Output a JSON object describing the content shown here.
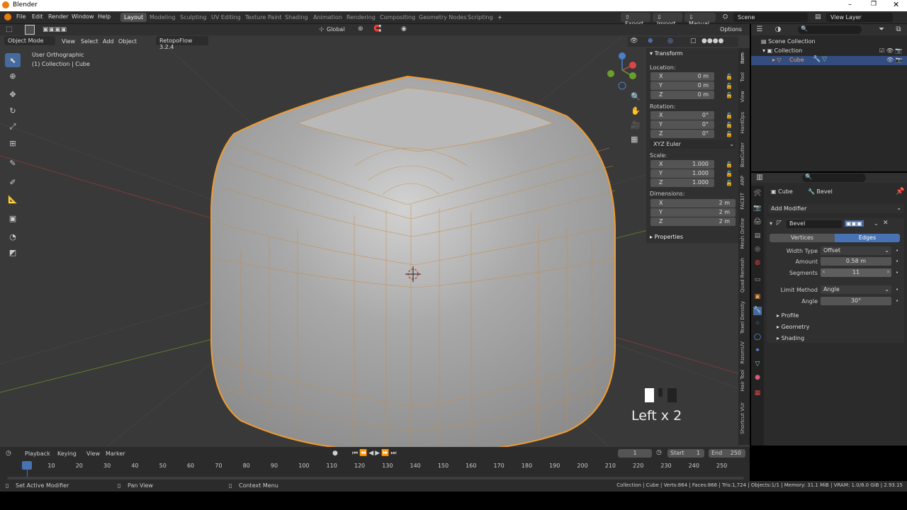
{
  "app": {
    "title": "Blender"
  },
  "menus": [
    "File",
    "Edit",
    "Render",
    "Window",
    "Help"
  ],
  "workspaces": [
    "Layout",
    "Modeling",
    "Sculpting",
    "UV Editing",
    "Texture Paint",
    "Shading",
    "Animation",
    "Rendering",
    "Compositing",
    "Geometry Nodes",
    "Scripting"
  ],
  "active_workspace": "Layout",
  "top_right": {
    "export": "Export",
    "import": "Import",
    "manual": "Manual",
    "scene": "Scene",
    "view_layer": "View Layer"
  },
  "viewport_header": {
    "orientation": "Global",
    "options": "Options",
    "mode": "Object Mode",
    "view": "View",
    "select": "Select",
    "add": "Add",
    "object": "Object",
    "addon": "RetopoFlow 3.2.4"
  },
  "viewport": {
    "view_name": "User Orthographic",
    "collection_info": "(1) Collection | Cube",
    "key_overlay": "Left x 2"
  },
  "npanel": {
    "header": "Transform",
    "location_label": "Location:",
    "location": [
      {
        "axis": "X",
        "value": "0 m"
      },
      {
        "axis": "Y",
        "value": "0 m"
      },
      {
        "axis": "Z",
        "value": "0 m"
      }
    ],
    "rotation_label": "Rotation:",
    "rotation": [
      {
        "axis": "X",
        "value": "0°"
      },
      {
        "axis": "Y",
        "value": "0°"
      },
      {
        "axis": "Z",
        "value": "0°"
      }
    ],
    "rotation_mode": "XYZ Euler",
    "scale_label": "Scale:",
    "scale": [
      {
        "axis": "X",
        "value": "1.000"
      },
      {
        "axis": "Y",
        "value": "1.000"
      },
      {
        "axis": "Z",
        "value": "1.000"
      }
    ],
    "dimensions_label": "Dimensions:",
    "dimensions": [
      {
        "axis": "X",
        "value": "2 m"
      },
      {
        "axis": "Y",
        "value": "2 m"
      },
      {
        "axis": "Z",
        "value": "2 m"
      }
    ],
    "properties": "Properties"
  },
  "side_tabs": [
    "Item",
    "Tool",
    "View",
    "HardOps",
    "BoxCutter",
    "ARP",
    "FACEIT",
    "Mesh Online",
    "Quad Remesh",
    "Texel Density",
    "RizomUV",
    "Hair Tool",
    "Shortcut VUr"
  ],
  "outliner": {
    "scene_collection": "Scene Collection",
    "collection": "Collection",
    "cube": "Cube"
  },
  "properties": {
    "object": "Cube",
    "modifier_name_breadcrumb": "Bevel",
    "add_modifier": "Add Modifier",
    "modifier": {
      "name": "Bevel",
      "tab_vertices": "Vertices",
      "tab_edges": "Edges",
      "width_type_label": "Width Type",
      "width_type": "Offset",
      "amount_label": "Amount",
      "amount": "0.58 m",
      "segments_label": "Segments",
      "segments": "11",
      "limit_method_label": "Limit Method",
      "limit_method": "Angle",
      "angle_label": "Angle",
      "angle": "30°",
      "sub_profile": "Profile",
      "sub_geometry": "Geometry",
      "sub_shading": "Shading"
    }
  },
  "timeline": {
    "playback": "Playback",
    "keying": "Keying",
    "view": "View",
    "marker": "Marker",
    "current_frame": "1",
    "start_label": "Start",
    "start": "1",
    "end_label": "End",
    "end": "250",
    "ticks": [
      "1",
      "10",
      "20",
      "30",
      "40",
      "50",
      "60",
      "70",
      "80",
      "90",
      "100",
      "110",
      "120",
      "130",
      "140",
      "150",
      "160",
      "170",
      "180",
      "190",
      "200",
      "210",
      "220",
      "230",
      "240",
      "250"
    ]
  },
  "status": {
    "left": "Set Active Modifier",
    "middle": "Pan View",
    "right": "Context Menu",
    "stats": "Collection | Cube | Verts:864 | Faces:866 | Tris:1,724 | Objects:1/1 | Memory: 31.1 MiB | VRAM: 1.0/8.0 GiB | 2.93.15"
  },
  "colors": {
    "accent": "#4772b3",
    "selection": "#f5a030",
    "viewport_bg": "#393939",
    "x_axis": "#c43a3a",
    "y_axis": "#6b9e2b"
  }
}
